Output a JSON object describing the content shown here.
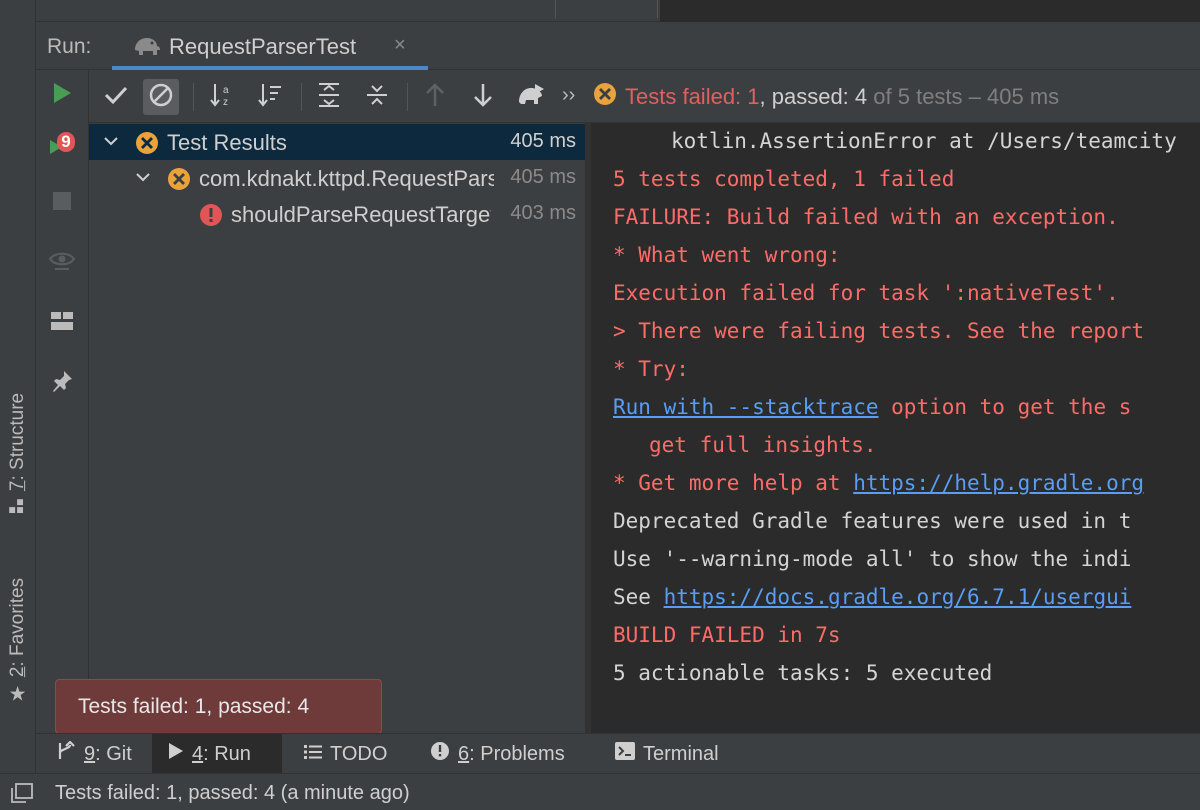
{
  "run_panel": {
    "label": "Run:",
    "tab_title": "RequestParserTest",
    "close_glyph": "×"
  },
  "toolbar": {
    "status_failed": "Tests failed: 1",
    "status_passed": ", passed: 4",
    "status_rest": "of 5 tests – 405 ms",
    "more_glyph": "››"
  },
  "vtoolbar": {
    "rerun_failed_badge": "9"
  },
  "tree": {
    "rows": [
      {
        "name": "Test Results",
        "time": "405 ms",
        "status": "ignored-failed"
      },
      {
        "name": "com.kdnakt.kttpd.RequestParserTest",
        "time": "405 ms",
        "status": "ignored-failed"
      },
      {
        "name": "shouldParseRequestTarget",
        "time": "403 ms",
        "status": "error"
      }
    ]
  },
  "console": {
    "lines": [
      {
        "parts": [
          {
            "text": "  kotlin.AssertionError at /Users/teamcity",
            "style": "norm"
          }
        ]
      },
      {
        "parts": [
          {
            "text": "5 tests completed, 1 failed",
            "style": "err"
          }
        ]
      },
      {
        "parts": [
          {
            "text": "FAILURE: Build failed with an exception.",
            "style": "err"
          }
        ]
      },
      {
        "parts": [
          {
            "text": "* What went wrong:",
            "style": "err"
          }
        ]
      },
      {
        "parts": [
          {
            "text": "Execution failed for task ':nativeTest'.",
            "style": "err"
          }
        ]
      },
      {
        "parts": [
          {
            "text": "> There were failing tests. See the report",
            "style": "err"
          }
        ]
      },
      {
        "parts": [
          {
            "text": "* Try:",
            "style": "err"
          }
        ]
      },
      {
        "parts": [
          {
            "text": "Run with --stacktrace",
            "style": "link"
          },
          {
            "text": " option to get the s",
            "style": "err"
          }
        ]
      },
      {
        "parts": [
          {
            "text": " get full insights.",
            "style": "err"
          }
        ]
      },
      {
        "parts": [
          {
            "text": "* Get more help at ",
            "style": "err"
          },
          {
            "text": "https://help.gradle.org",
            "style": "link"
          }
        ]
      },
      {
        "parts": [
          {
            "text": "Deprecated Gradle features were used in t",
            "style": "norm"
          }
        ]
      },
      {
        "parts": [
          {
            "text": "Use '--warning-mode all' to show the indi",
            "style": "norm"
          }
        ]
      },
      {
        "parts": [
          {
            "text": "See ",
            "style": "norm"
          },
          {
            "text": "https://docs.gradle.org/6.7.1/usergui",
            "style": "link"
          }
        ]
      },
      {
        "parts": [
          {
            "text": "BUILD FAILED in 7s",
            "style": "err"
          }
        ]
      },
      {
        "parts": [
          {
            "text": "5 actionable tasks: 5 executed",
            "style": "norm"
          }
        ]
      }
    ]
  },
  "tooltip": {
    "text": "Tests failed: 1, passed: 4"
  },
  "left_stripe": {
    "structure": {
      "num": "7",
      "label": ": Structure"
    },
    "favorites": {
      "num": "2",
      "label": ": Favorites"
    }
  },
  "bottom_tabs": {
    "git": {
      "num": "9",
      "label": ": Git"
    },
    "run": {
      "num": "4",
      "label": ": Run"
    },
    "todo": {
      "label": "TODO"
    },
    "problems": {
      "num": "6",
      "label": ": Problems"
    },
    "terminal": {
      "label": "Terminal"
    }
  },
  "status_bar": {
    "text": "Tests failed: 1, passed: 4 (a minute ago)"
  },
  "colors": {
    "run_green": "#499c54",
    "error_red": "#ff6b68",
    "ignored_orange": "#e8a33d",
    "link_blue": "#589df6",
    "selection": "#0d293e"
  }
}
